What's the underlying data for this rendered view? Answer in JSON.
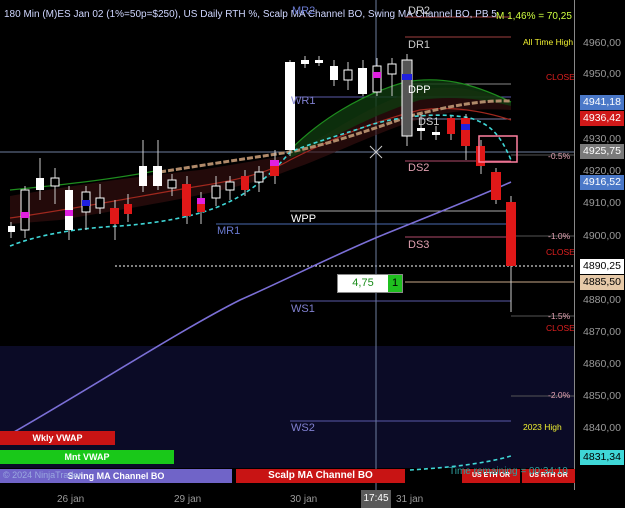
{
  "header": {
    "title": "180 Min (M)ES Jan 02 (1%=50p=$250), US Daily RTH %, Scalp MA Channel BO, Swing MA Channel BO, PB 5",
    "top_right": "M 1,46% = 70,25"
  },
  "levels": {
    "dr2": "DR2",
    "mr2": "MR2",
    "dr1": "DR1",
    "dpp": "DPP",
    "wr1": "WR1",
    "ds1": "DS1",
    "ds2": "DS2",
    "mr1": "MR1",
    "wpp": "WPP",
    "ds3": "DS3",
    "ws1": "WS1",
    "ws2": "WS2"
  },
  "annotations": {
    "ath": "All Time High",
    "close1": "CLOSE",
    "pct_neg05": "-0.5%",
    "pct_neg1": "-1.0%",
    "close2": "CLOSE",
    "pct_neg15": "-1.5%",
    "close3": "CLOSE",
    "pct_neg2": "-2.0%",
    "high2023": "2023 High"
  },
  "y_axis": {
    "labels": [
      "4960,00",
      "4950,00",
      "4930,00",
      "4920,00",
      "4910,00",
      "4900,00",
      "4880,00",
      "4870,00",
      "4860,00",
      "4850,00",
      "4840,00"
    ],
    "price_tags": [
      {
        "value": "4941,18",
        "bg": "#4a78c8",
        "fg": "#ffffff"
      },
      {
        "value": "4936,42",
        "bg": "#d01919",
        "fg": "#ffffff"
      },
      {
        "value": "4925,75",
        "bg": "#7a7a7a",
        "fg": "#ffffff"
      },
      {
        "value": "4916,52",
        "bg": "#4a78c8",
        "fg": "#ffffff"
      },
      {
        "value": "4890,25",
        "bg": "#ffffff",
        "fg": "#000000"
      },
      {
        "value": "4885,50",
        "bg": "#e6c9a8",
        "fg": "#000000"
      },
      {
        "value": "4831,34",
        "bg": "#3fd7d7",
        "fg": "#000000"
      }
    ]
  },
  "x_axis": {
    "labels": [
      "26 jan",
      "29 jan",
      "30 jan",
      "31 jan"
    ],
    "cursor": "17:45"
  },
  "position": {
    "qty": "4,75",
    "count": "1"
  },
  "buttons": {
    "wkly_vwap": "Wkly VWAP",
    "mnt_vwap": "Mnt VWAP",
    "swing": "Swing MA Channel BO",
    "scalp": "Scalp MA Channel BO",
    "us_eth": "US ETH OR",
    "us_rth": "US RTH OR"
  },
  "footer": {
    "copyright": "© 2024 NinjaTrader",
    "timer": "Time remaining = 00:34:10"
  },
  "colors": {
    "bull": "#ffffff",
    "bear": "#e01818",
    "vwap": "#3fd7d7",
    "sma": "#b08a6a",
    "ema": "#1e8c1e",
    "swing": "#7b6fd6"
  }
}
